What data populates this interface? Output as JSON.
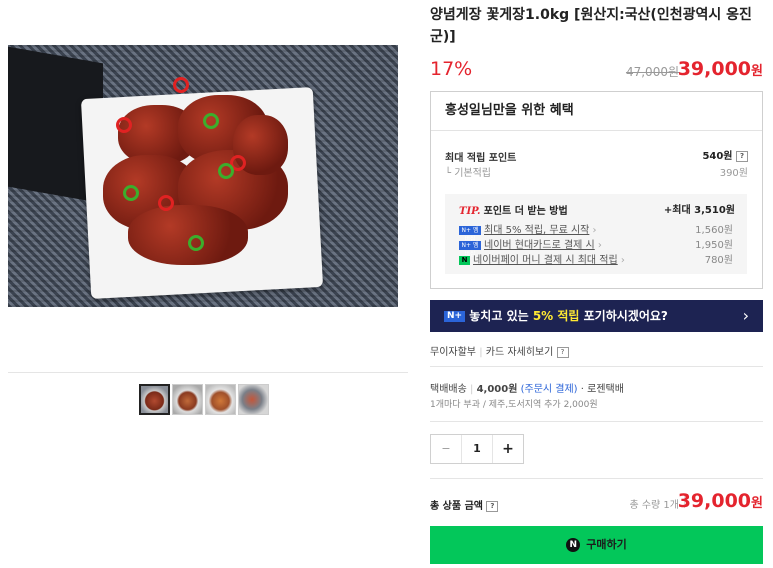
{
  "product": {
    "title": "양념게장 꽃게장1.0kg [원산지:국산(인천광역시 옹진군)]",
    "discount_rate": "17%",
    "original_price": "47,000원",
    "price_value": "39,000",
    "price_unit": "원"
  },
  "benefit": {
    "heading": "홍성일님만을 위한 혜택",
    "max_points_label": "최대 적립 포인트",
    "max_points_value": "540원",
    "base_label": "기본적립",
    "base_value": "390원",
    "tip_label": "TIP.",
    "tip_text": "포인트 더 받는 방법",
    "tip_max": "+최대 3,510원",
    "tips": [
      {
        "badge": "N+ 멤버십",
        "label": "최대 5% 적립, 무료 시작",
        "value": "1,560원"
      },
      {
        "badge": "N+ 멤버십",
        "label": "네이버 현대카드로 결제 시",
        "value": "1,950원"
      },
      {
        "badge": "N",
        "label": "네이버페이 머니 결제 시 최대 적립",
        "value": "780원"
      }
    ]
  },
  "banner": {
    "badge": "N+",
    "text_before": "놓치고 있는 ",
    "highlight": "5% 적립",
    "text_after": " 포기하시겠어요?",
    "arrow": "›",
    "highlight_color": "#ffe933"
  },
  "payment": {
    "installment": "무이자할부",
    "card_detail": "카드 자세히보기",
    "help": "?"
  },
  "shipping": {
    "method": "택배배송",
    "fee": "4,000원",
    "fee_note": "(주문시 결제)",
    "carrier": "로젠택배",
    "note": "1개마다 부과 / 제주,도서지역 추가 2,000원"
  },
  "quantity": {
    "minus": "−",
    "value": "1",
    "plus": "+"
  },
  "total": {
    "label": "총 상품 금액",
    "help": "?",
    "count": "총 수량 1개",
    "price_value": "39,000",
    "price_unit": "원"
  },
  "buy": {
    "icon": "N",
    "label": "구매하기"
  },
  "colors": {
    "accent_red": "#e4242e",
    "naver_green": "#03c75a",
    "banner_navy": "#1d2352"
  }
}
